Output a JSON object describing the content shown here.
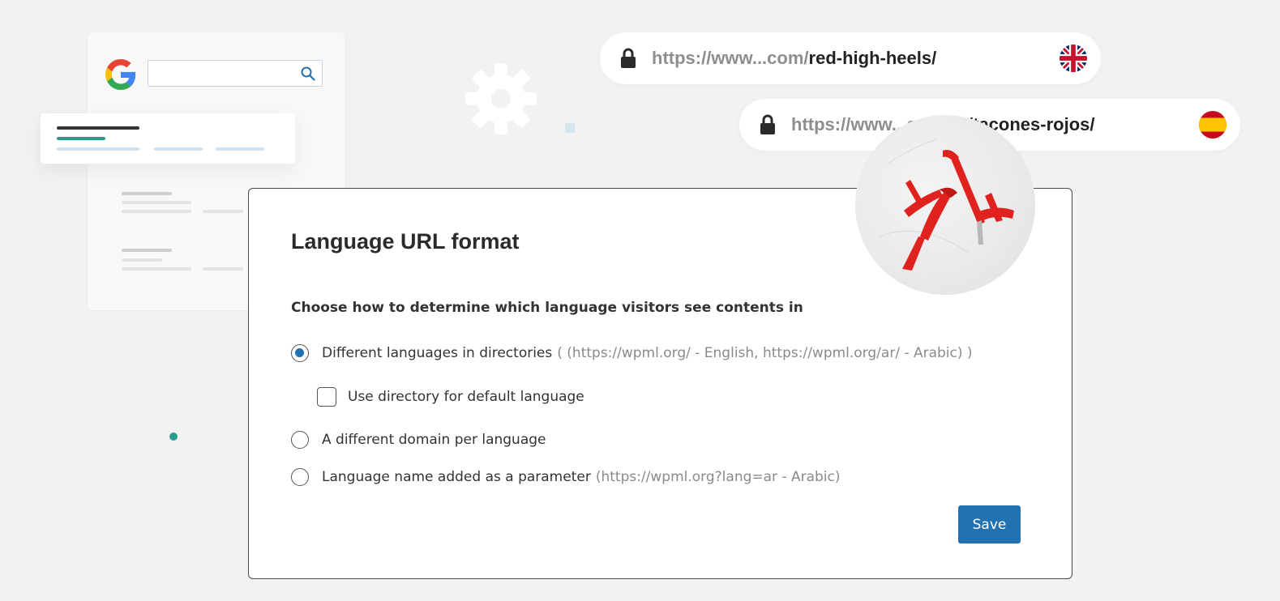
{
  "search_mockup": {
    "icons": [
      "google-g-icon",
      "search-icon"
    ]
  },
  "urls": [
    {
      "prefix": "https://www...com/",
      "path": "red-high-heels/",
      "flag": "uk-flag-icon"
    },
    {
      "prefix": "https://www...com/",
      "path": "es/tacones-rojos/",
      "flag": "spain-flag-icon"
    }
  ],
  "settings": {
    "title": "Language URL format",
    "subtitle": "Choose how to determine which language visitors see contents in",
    "options": [
      {
        "label": "Different languages in directories",
        "hint": "( (https://wpml.org/ - English, https://wpml.org/ar/ - Arabic) )",
        "checked": true
      },
      {
        "label": "A different domain per language",
        "hint": "",
        "checked": false
      },
      {
        "label": "Language name added as a parameter",
        "hint": "(https://wpml.org?lang=ar - Arabic)",
        "checked": false
      }
    ],
    "sub_option": {
      "label": "Use directory for default language",
      "checked": false
    },
    "save_label": "Save"
  },
  "colors": {
    "accent": "#2271b1",
    "background": "#f2f2f2",
    "teal": "#2a9d8f"
  }
}
